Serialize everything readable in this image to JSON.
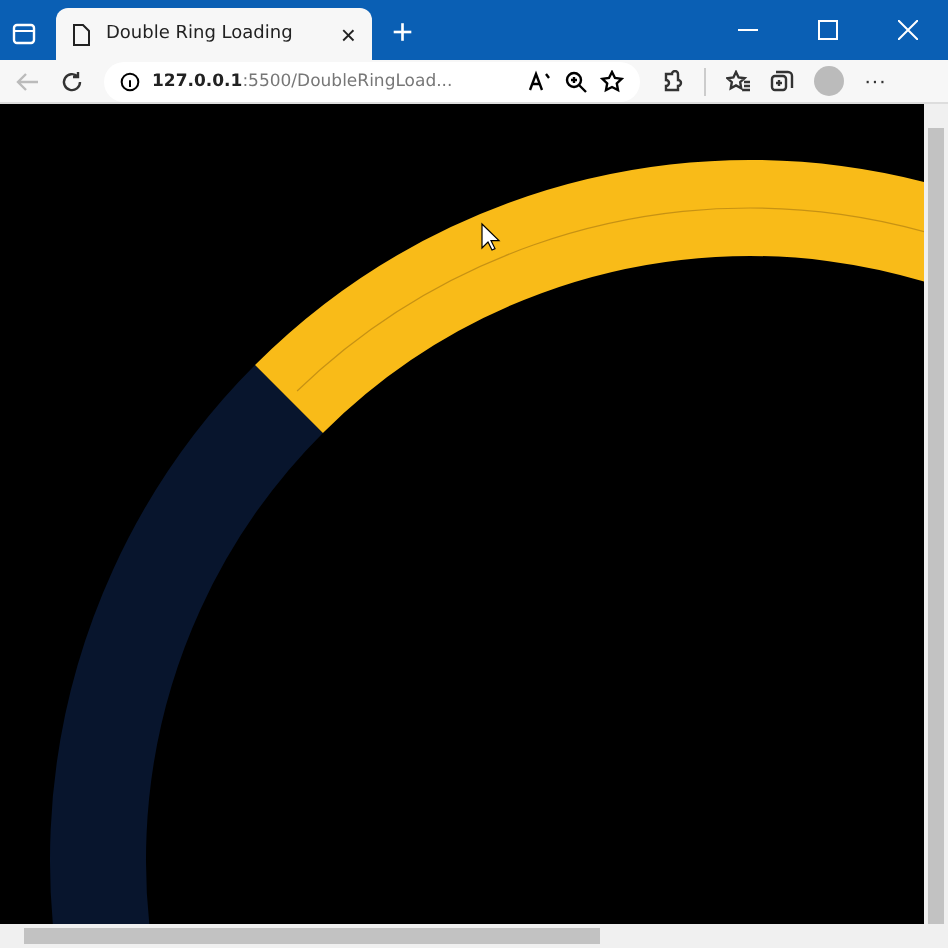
{
  "tab": {
    "title": "Double Ring Loading",
    "close": "×",
    "new_tab": "+"
  },
  "address_bar": {
    "url": "**127.0.0.1**:5500/DoubleRingLoad..."
  },
  "menu": "···"
}
